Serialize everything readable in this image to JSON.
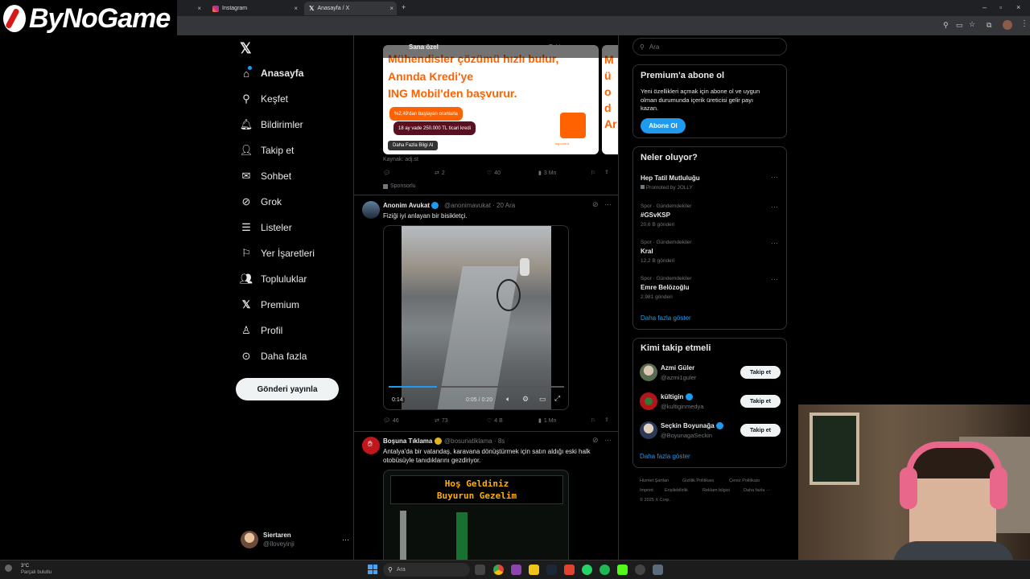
{
  "browser": {
    "tabs": [
      {
        "label": ""
      },
      {
        "label": "Instagram"
      },
      {
        "label": "Anasayfa / X"
      }
    ],
    "new_tab": "+"
  },
  "overlay_logo": "ByNoGame",
  "nav": {
    "items": [
      {
        "label": "Anasayfa",
        "icon": "home-icon"
      },
      {
        "label": "Keşfet",
        "icon": "search-icon"
      },
      {
        "label": "Bildirimler",
        "icon": "bell-icon"
      },
      {
        "label": "Takip et",
        "icon": "follow-icon"
      },
      {
        "label": "Sohbet",
        "icon": "mail-icon"
      },
      {
        "label": "Grok",
        "icon": "grok-icon"
      },
      {
        "label": "Listeler",
        "icon": "list-icon"
      },
      {
        "label": "Yer İşaretleri",
        "icon": "bookmark-icon"
      },
      {
        "label": "Topluluklar",
        "icon": "community-icon"
      },
      {
        "label": "Premium",
        "icon": "x-icon"
      },
      {
        "label": "Profil",
        "icon": "person-icon"
      },
      {
        "label": "Daha fazla",
        "icon": "more-circle-icon"
      }
    ],
    "post_button": "Gönderi yayınla",
    "account": {
      "name": "Siertaren",
      "handle": "@Iloveyinji",
      "more": "···"
    }
  },
  "feed": {
    "tabs": [
      "Sana özel",
      "Takip"
    ],
    "ad": {
      "headline_top": "Mühendisler çözümü hızlı bulur,",
      "headline_1": "Anında Kredi'ye",
      "headline_2": "ING Mobil'den başvurur.",
      "pill_1": "%2,49'dan başlayan oranlarla",
      "pill_2": "18 ay vade 250.000 TL ticari kredi",
      "cta": "Daha Fazla Bilgi Al",
      "brand_caption": "ing.com.tr",
      "source": "Kaynak: adj.st",
      "second_frame": "Mü od Ar",
      "stats": {
        "reposts": "2",
        "likes": "40",
        "views": "3 Mn"
      },
      "sponsored": "Sponsorlu"
    },
    "tweet1": {
      "name": "Anonim Avukat",
      "handle": "@anonimavukat",
      "date": "· 20 Ara",
      "text": "Fiziği iyi anlayan bir bisikletçi.",
      "video_elapsed": "0:14",
      "video_time": "0:05 / 0:20",
      "stats": {
        "replies": "46",
        "reposts": "73",
        "likes": "4 B",
        "views": "1 Mn"
      }
    },
    "tweet2": {
      "name": "Boşuna Tıklama",
      "handle": "@bosunatiklama",
      "date": "· 8s",
      "text_1": "Antalya'da bir vatandaş, karavana dönüştürmek için satın aldığı eski halk",
      "text_2": "otobüsüyle tanıdıklarını gezdiriyor.",
      "bus_sign_1": "Hoş Geldiniz",
      "bus_sign_2": "Buyurun Gezelim"
    }
  },
  "sidebar": {
    "search_placeholder": "Ara",
    "premium": {
      "title": "Premium'a abone ol",
      "body_1": "Yeni özellikleri açmak için abone ol ve uygun",
      "body_2": "olman durumunda içerik üreticisi gelir payı",
      "body_3": "kazan.",
      "button": "Abone Ol"
    },
    "trends": {
      "title": "Neler oluyor?",
      "items": [
        {
          "category": "",
          "name": "Hep Tatil Mutluluğu",
          "count": "Promoted by JOLLY"
        },
        {
          "category": "Spor · Gündemdekiler",
          "name": "#GSvKSP",
          "count": "20,6 B gönderi"
        },
        {
          "category": "Spor · Gündemdekiler",
          "name": "Kral",
          "count": "12,2 B gönderi"
        },
        {
          "category": "Spor · Gündemdekiler",
          "name": "Emre Belözoğlu",
          "count": "2.981 gönderi"
        }
      ],
      "show_more": "Daha fazla göster"
    },
    "who_to_follow": {
      "title": "Kimi takip etmeli",
      "items": [
        {
          "name": "Azmi Güler",
          "handle": "@azmi1guler",
          "button": "Takip et"
        },
        {
          "name": "kültigin",
          "handle": "@kultiginmedya",
          "button": "Takip et"
        },
        {
          "name": "Seçkin Boyunağa",
          "handle": "@BoyunagaSeckin",
          "button": "Takip et"
        }
      ],
      "show_more": "Daha fazla göster"
    },
    "footer": {
      "links": [
        "Hizmet Şartları",
        "Gizlilik Politikası",
        "Çerez Politikası",
        "Imprint",
        "Erişilebilirlik",
        "Reklam bilgisi",
        "Daha fazla ···"
      ],
      "copyright": "© 2025 X Corp."
    }
  },
  "taskbar": {
    "weather_temp": "3°C",
    "weather_desc": "Parçalı bulutlu",
    "search": "Ara"
  },
  "colors": {
    "accent": "#1d9bf0",
    "ing_orange": "#ff6200",
    "bg": "#000000"
  }
}
